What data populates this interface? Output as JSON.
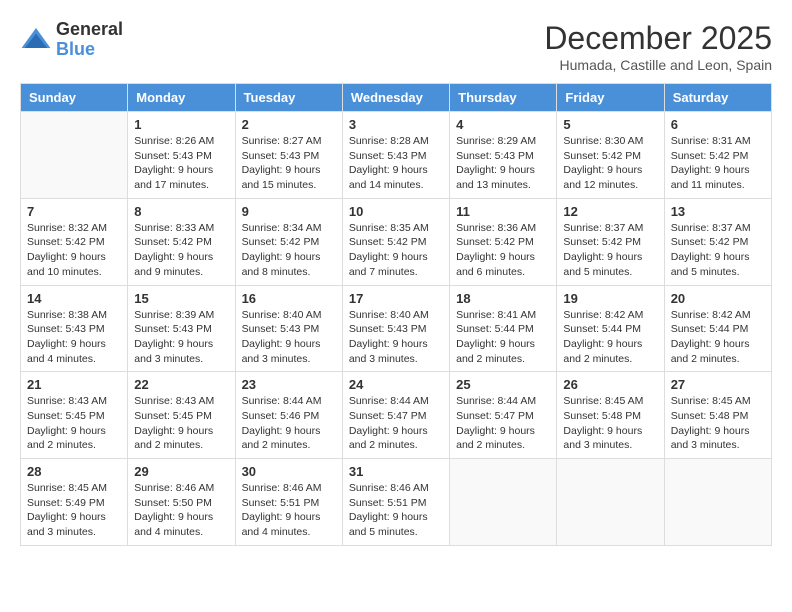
{
  "logo": {
    "general": "General",
    "blue": "Blue"
  },
  "title": "December 2025",
  "location": "Humada, Castille and Leon, Spain",
  "days_of_week": [
    "Sunday",
    "Monday",
    "Tuesday",
    "Wednesday",
    "Thursday",
    "Friday",
    "Saturday"
  ],
  "weeks": [
    [
      {
        "day": "",
        "empty": true
      },
      {
        "day": "1",
        "sunrise": "Sunrise: 8:26 AM",
        "sunset": "Sunset: 5:43 PM",
        "daylight": "Daylight: 9 hours and 17 minutes."
      },
      {
        "day": "2",
        "sunrise": "Sunrise: 8:27 AM",
        "sunset": "Sunset: 5:43 PM",
        "daylight": "Daylight: 9 hours and 15 minutes."
      },
      {
        "day": "3",
        "sunrise": "Sunrise: 8:28 AM",
        "sunset": "Sunset: 5:43 PM",
        "daylight": "Daylight: 9 hours and 14 minutes."
      },
      {
        "day": "4",
        "sunrise": "Sunrise: 8:29 AM",
        "sunset": "Sunset: 5:43 PM",
        "daylight": "Daylight: 9 hours and 13 minutes."
      },
      {
        "day": "5",
        "sunrise": "Sunrise: 8:30 AM",
        "sunset": "Sunset: 5:42 PM",
        "daylight": "Daylight: 9 hours and 12 minutes."
      },
      {
        "day": "6",
        "sunrise": "Sunrise: 8:31 AM",
        "sunset": "Sunset: 5:42 PM",
        "daylight": "Daylight: 9 hours and 11 minutes."
      }
    ],
    [
      {
        "day": "7",
        "sunrise": "Sunrise: 8:32 AM",
        "sunset": "Sunset: 5:42 PM",
        "daylight": "Daylight: 9 hours and 10 minutes."
      },
      {
        "day": "8",
        "sunrise": "Sunrise: 8:33 AM",
        "sunset": "Sunset: 5:42 PM",
        "daylight": "Daylight: 9 hours and 9 minutes."
      },
      {
        "day": "9",
        "sunrise": "Sunrise: 8:34 AM",
        "sunset": "Sunset: 5:42 PM",
        "daylight": "Daylight: 9 hours and 8 minutes."
      },
      {
        "day": "10",
        "sunrise": "Sunrise: 8:35 AM",
        "sunset": "Sunset: 5:42 PM",
        "daylight": "Daylight: 9 hours and 7 minutes."
      },
      {
        "day": "11",
        "sunrise": "Sunrise: 8:36 AM",
        "sunset": "Sunset: 5:42 PM",
        "daylight": "Daylight: 9 hours and 6 minutes."
      },
      {
        "day": "12",
        "sunrise": "Sunrise: 8:37 AM",
        "sunset": "Sunset: 5:42 PM",
        "daylight": "Daylight: 9 hours and 5 minutes."
      },
      {
        "day": "13",
        "sunrise": "Sunrise: 8:37 AM",
        "sunset": "Sunset: 5:42 PM",
        "daylight": "Daylight: 9 hours and 5 minutes."
      }
    ],
    [
      {
        "day": "14",
        "sunrise": "Sunrise: 8:38 AM",
        "sunset": "Sunset: 5:43 PM",
        "daylight": "Daylight: 9 hours and 4 minutes."
      },
      {
        "day": "15",
        "sunrise": "Sunrise: 8:39 AM",
        "sunset": "Sunset: 5:43 PM",
        "daylight": "Daylight: 9 hours and 3 minutes."
      },
      {
        "day": "16",
        "sunrise": "Sunrise: 8:40 AM",
        "sunset": "Sunset: 5:43 PM",
        "daylight": "Daylight: 9 hours and 3 minutes."
      },
      {
        "day": "17",
        "sunrise": "Sunrise: 8:40 AM",
        "sunset": "Sunset: 5:43 PM",
        "daylight": "Daylight: 9 hours and 3 minutes."
      },
      {
        "day": "18",
        "sunrise": "Sunrise: 8:41 AM",
        "sunset": "Sunset: 5:44 PM",
        "daylight": "Daylight: 9 hours and 2 minutes."
      },
      {
        "day": "19",
        "sunrise": "Sunrise: 8:42 AM",
        "sunset": "Sunset: 5:44 PM",
        "daylight": "Daylight: 9 hours and 2 minutes."
      },
      {
        "day": "20",
        "sunrise": "Sunrise: 8:42 AM",
        "sunset": "Sunset: 5:44 PM",
        "daylight": "Daylight: 9 hours and 2 minutes."
      }
    ],
    [
      {
        "day": "21",
        "sunrise": "Sunrise: 8:43 AM",
        "sunset": "Sunset: 5:45 PM",
        "daylight": "Daylight: 9 hours and 2 minutes."
      },
      {
        "day": "22",
        "sunrise": "Sunrise: 8:43 AM",
        "sunset": "Sunset: 5:45 PM",
        "daylight": "Daylight: 9 hours and 2 minutes."
      },
      {
        "day": "23",
        "sunrise": "Sunrise: 8:44 AM",
        "sunset": "Sunset: 5:46 PM",
        "daylight": "Daylight: 9 hours and 2 minutes."
      },
      {
        "day": "24",
        "sunrise": "Sunrise: 8:44 AM",
        "sunset": "Sunset: 5:47 PM",
        "daylight": "Daylight: 9 hours and 2 minutes."
      },
      {
        "day": "25",
        "sunrise": "Sunrise: 8:44 AM",
        "sunset": "Sunset: 5:47 PM",
        "daylight": "Daylight: 9 hours and 2 minutes."
      },
      {
        "day": "26",
        "sunrise": "Sunrise: 8:45 AM",
        "sunset": "Sunset: 5:48 PM",
        "daylight": "Daylight: 9 hours and 3 minutes."
      },
      {
        "day": "27",
        "sunrise": "Sunrise: 8:45 AM",
        "sunset": "Sunset: 5:48 PM",
        "daylight": "Daylight: 9 hours and 3 minutes."
      }
    ],
    [
      {
        "day": "28",
        "sunrise": "Sunrise: 8:45 AM",
        "sunset": "Sunset: 5:49 PM",
        "daylight": "Daylight: 9 hours and 3 minutes."
      },
      {
        "day": "29",
        "sunrise": "Sunrise: 8:46 AM",
        "sunset": "Sunset: 5:50 PM",
        "daylight": "Daylight: 9 hours and 4 minutes."
      },
      {
        "day": "30",
        "sunrise": "Sunrise: 8:46 AM",
        "sunset": "Sunset: 5:51 PM",
        "daylight": "Daylight: 9 hours and 4 minutes."
      },
      {
        "day": "31",
        "sunrise": "Sunrise: 8:46 AM",
        "sunset": "Sunset: 5:51 PM",
        "daylight": "Daylight: 9 hours and 5 minutes."
      },
      {
        "day": "",
        "empty": true
      },
      {
        "day": "",
        "empty": true
      },
      {
        "day": "",
        "empty": true
      }
    ]
  ]
}
